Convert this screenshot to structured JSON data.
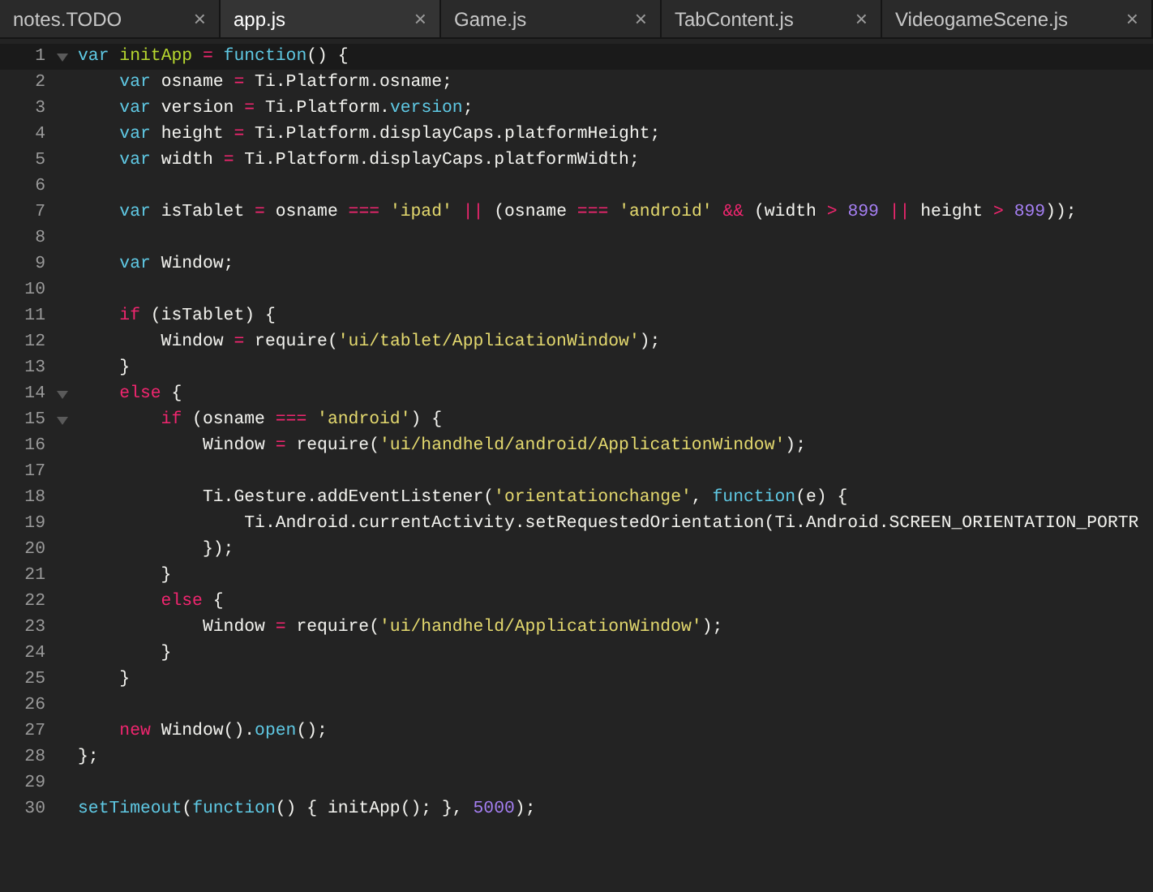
{
  "tabs": [
    {
      "label": "notes.TODO",
      "selected": false,
      "close": "×"
    },
    {
      "label": "app.js",
      "selected": true,
      "close": "×"
    },
    {
      "label": "Game.js",
      "selected": false,
      "close": "×"
    },
    {
      "label": "TabContent.js",
      "selected": false,
      "close": "×"
    },
    {
      "label": "VideogameScene.js",
      "selected": false,
      "close": "×"
    }
  ],
  "lines": [
    {
      "number": "1",
      "foldable": true,
      "current": true,
      "tokens": [
        {
          "text": "var",
          "kind": "storage"
        },
        {
          "text": " initApp",
          "kind": "fn"
        },
        {
          "text": " =",
          "kind": "op"
        },
        {
          "text": " function",
          "kind": "storage"
        },
        {
          "text": "() {",
          "kind": "plain"
        }
      ]
    },
    {
      "number": "2",
      "foldable": false,
      "current": false,
      "tokens": [
        {
          "text": "    var",
          "kind": "storage"
        },
        {
          "text": " osname ",
          "kind": "plain"
        },
        {
          "text": "=",
          "kind": "op"
        },
        {
          "text": " Ti.Platform.osname;",
          "kind": "plain"
        }
      ]
    },
    {
      "number": "3",
      "foldable": false,
      "current": false,
      "tokens": [
        {
          "text": "    var",
          "kind": "storage"
        },
        {
          "text": " version ",
          "kind": "plain"
        },
        {
          "text": "=",
          "kind": "op"
        },
        {
          "text": " Ti.Platform.",
          "kind": "plain"
        },
        {
          "text": "version",
          "kind": "prop"
        },
        {
          "text": ";",
          "kind": "plain"
        }
      ]
    },
    {
      "number": "4",
      "foldable": false,
      "current": false,
      "tokens": [
        {
          "text": "    var",
          "kind": "storage"
        },
        {
          "text": " height ",
          "kind": "plain"
        },
        {
          "text": "=",
          "kind": "op"
        },
        {
          "text": " Ti.Platform.displayCaps.platformHeight;",
          "kind": "plain"
        }
      ]
    },
    {
      "number": "5",
      "foldable": false,
      "current": false,
      "tokens": [
        {
          "text": "    var",
          "kind": "storage"
        },
        {
          "text": " width ",
          "kind": "plain"
        },
        {
          "text": "=",
          "kind": "op"
        },
        {
          "text": " Ti.Platform.displayCaps.platformWidth;",
          "kind": "plain"
        }
      ]
    },
    {
      "number": "6",
      "foldable": false,
      "current": false
    },
    {
      "number": "7",
      "foldable": false,
      "current": false,
      "tokens": [
        {
          "text": "    var",
          "kind": "storage"
        },
        {
          "text": " isTablet ",
          "kind": "plain"
        },
        {
          "text": "=",
          "kind": "op"
        },
        {
          "text": " osname ",
          "kind": "plain"
        },
        {
          "text": "===",
          "kind": "op"
        },
        {
          "text": " 'ipad'",
          "kind": "str"
        },
        {
          "text": " ||",
          "kind": "op"
        },
        {
          "text": " (osname ",
          "kind": "plain"
        },
        {
          "text": "===",
          "kind": "op"
        },
        {
          "text": " 'android'",
          "kind": "str"
        },
        {
          "text": " &&",
          "kind": "op"
        },
        {
          "text": " (width ",
          "kind": "plain"
        },
        {
          "text": ">",
          "kind": "op"
        },
        {
          "text": " 899",
          "kind": "num"
        },
        {
          "text": " ||",
          "kind": "op"
        },
        {
          "text": " height ",
          "kind": "plain"
        },
        {
          "text": ">",
          "kind": "op"
        },
        {
          "text": " 899",
          "kind": "num"
        },
        {
          "text": "));",
          "kind": "plain"
        }
      ]
    },
    {
      "number": "8",
      "foldable": false,
      "current": false
    },
    {
      "number": "9",
      "foldable": false,
      "current": false,
      "tokens": [
        {
          "text": "    var",
          "kind": "storage"
        },
        {
          "text": " Window;",
          "kind": "plain"
        }
      ]
    },
    {
      "number": "10",
      "foldable": false,
      "current": false
    },
    {
      "number": "11",
      "foldable": false,
      "current": false,
      "tokens": [
        {
          "text": "    if",
          "kind": "kw"
        },
        {
          "text": " (isTablet) {",
          "kind": "plain"
        }
      ]
    },
    {
      "number": "12",
      "foldable": false,
      "current": false,
      "tokens": [
        {
          "text": "        Window ",
          "kind": "plain"
        },
        {
          "text": "=",
          "kind": "op"
        },
        {
          "text": " require(",
          "kind": "plain"
        },
        {
          "text": "'ui/tablet/ApplicationWindow'",
          "kind": "str"
        },
        {
          "text": ");",
          "kind": "plain"
        }
      ]
    },
    {
      "number": "13",
      "foldable": false,
      "current": false,
      "tokens": [
        {
          "text": "    }",
          "kind": "plain"
        }
      ]
    },
    {
      "number": "14",
      "foldable": true,
      "current": false,
      "tokens": [
        {
          "text": "    else",
          "kind": "kw"
        },
        {
          "text": " {",
          "kind": "plain"
        }
      ]
    },
    {
      "number": "15",
      "foldable": true,
      "current": false,
      "tokens": [
        {
          "text": "        if",
          "kind": "kw"
        },
        {
          "text": " (osname ",
          "kind": "plain"
        },
        {
          "text": "===",
          "kind": "op"
        },
        {
          "text": " 'android'",
          "kind": "str"
        },
        {
          "text": ") {",
          "kind": "plain"
        }
      ]
    },
    {
      "number": "16",
      "foldable": false,
      "current": false,
      "tokens": [
        {
          "text": "            Window ",
          "kind": "plain"
        },
        {
          "text": "=",
          "kind": "op"
        },
        {
          "text": " require(",
          "kind": "plain"
        },
        {
          "text": "'ui/handheld/android/ApplicationWindow'",
          "kind": "str"
        },
        {
          "text": ");",
          "kind": "plain"
        }
      ]
    },
    {
      "number": "17",
      "foldable": false,
      "current": false
    },
    {
      "number": "18",
      "foldable": false,
      "current": false,
      "tokens": [
        {
          "text": "            Ti.Gesture.addEventListener(",
          "kind": "plain"
        },
        {
          "text": "'orientationchange'",
          "kind": "str"
        },
        {
          "text": ",",
          "kind": "plain"
        },
        {
          "text": " function",
          "kind": "storage"
        },
        {
          "text": "(e) {",
          "kind": "plain"
        }
      ]
    },
    {
      "number": "19",
      "foldable": false,
      "current": false,
      "tokens": [
        {
          "text": "                Ti.Android.currentActivity.setRequestedOrientation(Ti.Android.SCREEN_ORIENTATION_PORTR",
          "kind": "plain"
        }
      ]
    },
    {
      "number": "20",
      "foldable": false,
      "current": false,
      "tokens": [
        {
          "text": "            });",
          "kind": "plain"
        }
      ]
    },
    {
      "number": "21",
      "foldable": false,
      "current": false,
      "tokens": [
        {
          "text": "        }",
          "kind": "plain"
        }
      ]
    },
    {
      "number": "22",
      "foldable": false,
      "current": false,
      "tokens": [
        {
          "text": "        else",
          "kind": "kw"
        },
        {
          "text": " {",
          "kind": "plain"
        }
      ]
    },
    {
      "number": "23",
      "foldable": false,
      "current": false,
      "tokens": [
        {
          "text": "            Window ",
          "kind": "plain"
        },
        {
          "text": "=",
          "kind": "op"
        },
        {
          "text": " require(",
          "kind": "plain"
        },
        {
          "text": "'ui/handheld/ApplicationWindow'",
          "kind": "str"
        },
        {
          "text": ");",
          "kind": "plain"
        }
      ]
    },
    {
      "number": "24",
      "foldable": false,
      "current": false,
      "tokens": [
        {
          "text": "        }",
          "kind": "plain"
        }
      ]
    },
    {
      "number": "25",
      "foldable": false,
      "current": false,
      "tokens": [
        {
          "text": "    }",
          "kind": "plain"
        }
      ]
    },
    {
      "number": "26",
      "foldable": false,
      "current": false
    },
    {
      "number": "27",
      "foldable": false,
      "current": false,
      "tokens": [
        {
          "text": "    new",
          "kind": "kw"
        },
        {
          "text": " Window().",
          "kind": "plain"
        },
        {
          "text": "open",
          "kind": "prop"
        },
        {
          "text": "();",
          "kind": "plain"
        }
      ]
    },
    {
      "number": "28",
      "foldable": false,
      "current": false,
      "tokens": [
        {
          "text": "};",
          "kind": "plain"
        }
      ]
    },
    {
      "number": "29",
      "foldable": false,
      "current": false
    },
    {
      "number": "30",
      "foldable": false,
      "current": false,
      "tokens": [
        {
          "text": "setTimeout",
          "kind": "prop"
        },
        {
          "text": "(",
          "kind": "plain"
        },
        {
          "text": "function",
          "kind": "storage"
        },
        {
          "text": "() { initApp(); },",
          "kind": "plain"
        },
        {
          "text": " 5000",
          "kind": "num"
        },
        {
          "text": ");",
          "kind": "plain"
        }
      ]
    }
  ]
}
